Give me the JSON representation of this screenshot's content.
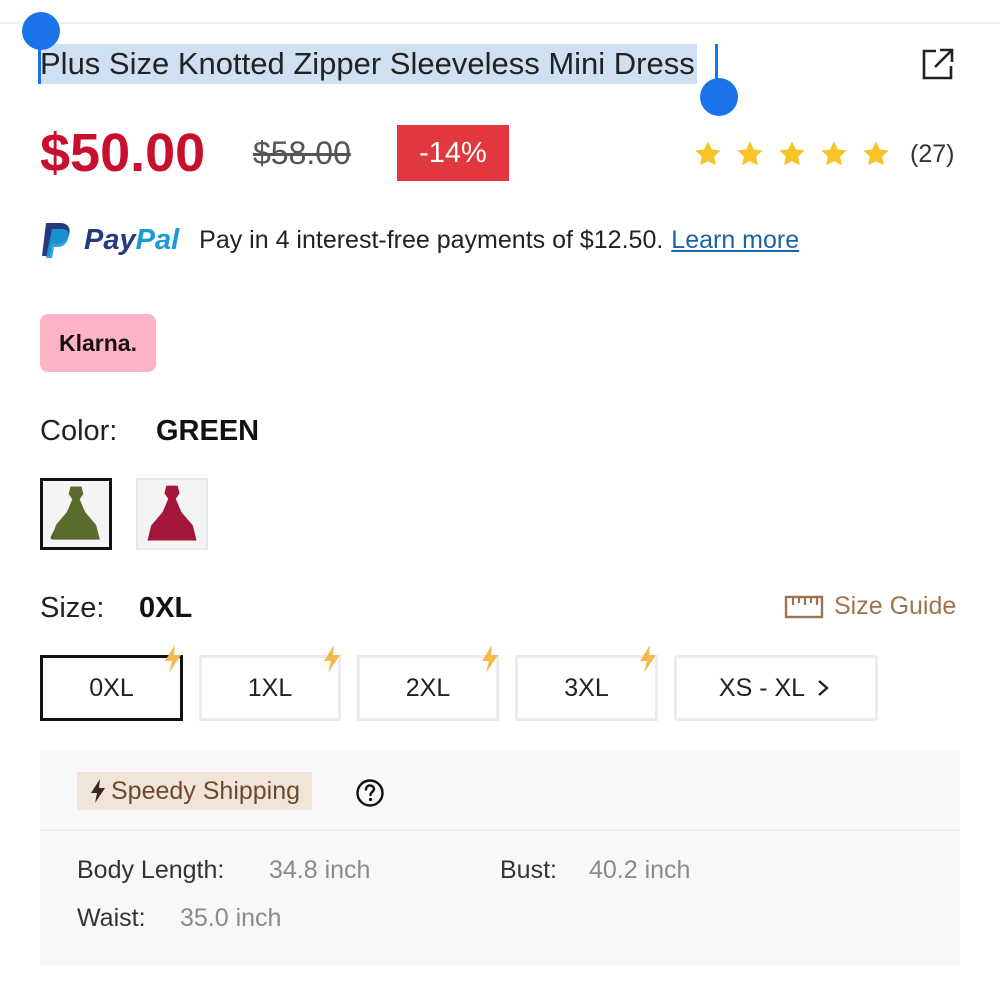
{
  "product": {
    "title": "Plus Size Knotted Zipper Sleeveless Mini Dress",
    "price": "$50.00",
    "original_price": "$58.00",
    "discount": "-14%",
    "rating": 5,
    "review_count": "(27)"
  },
  "paypal": {
    "logo_pay": "Pay",
    "logo_pal": "Pal",
    "message": "Pay in 4 interest-free payments of $12.50.",
    "learn_more": "Learn more"
  },
  "klarna": {
    "label": "Klarna."
  },
  "color": {
    "label": "Color:",
    "selected": "GREEN",
    "swatches": [
      {
        "name": "green",
        "hex": "#5a6b2e"
      },
      {
        "name": "red",
        "hex": "#a3163a"
      }
    ]
  },
  "size": {
    "label": "Size:",
    "selected": "0XL",
    "guide_label": "Size Guide",
    "options": [
      "0XL",
      "1XL",
      "2XL",
      "3XL",
      "XS - XL"
    ]
  },
  "shipping": {
    "badge": "Speedy Shipping",
    "specs": {
      "body_length_label": "Body Length:",
      "body_length_value": "34.8 inch",
      "bust_label": "Bust:",
      "bust_value": "40.2 inch",
      "waist_label": "Waist:",
      "waist_value": "35.0 inch"
    }
  },
  "colors": {
    "price_red": "#c8102e",
    "discount_bg": "#e0383e",
    "star_yellow": "#f7c325",
    "selection_blue": "#1a73e8",
    "guide_brown": "#a0734f",
    "bolt_orange": "#f2b94c"
  }
}
